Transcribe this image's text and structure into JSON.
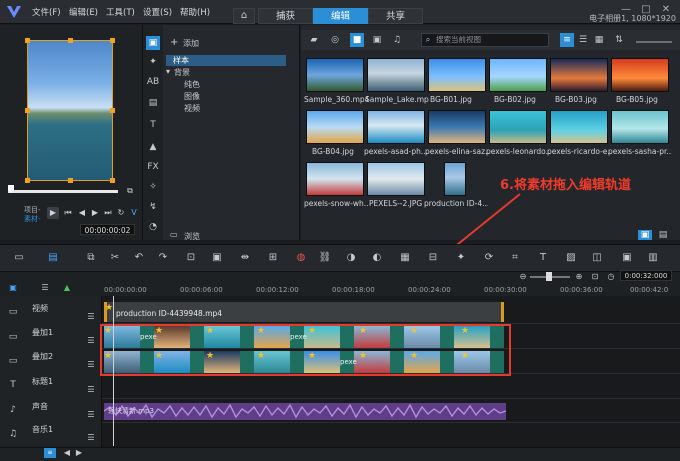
{
  "menu": [
    "文件(F)",
    "编辑(E)",
    "工具(T)",
    "设置(S)",
    "帮助(H)"
  ],
  "tabs": [
    "捕获",
    "编辑",
    "共享"
  ],
  "project_info": "电子相册1, 1080*1920",
  "player": {
    "mode_project": "项目-",
    "mode_clip": "素材-",
    "timecode": "00:00:00:02"
  },
  "library": {
    "add_label": "添加",
    "tree": {
      "sample": "样本",
      "background": "背景",
      "solid": "纯色",
      "image": "图像",
      "video": "视频"
    },
    "browse_label": "浏览",
    "search_placeholder": "搜索当前视图",
    "items": [
      "Sample_360.mp4",
      "Sample_Lake.mp4",
      "BG-B01.jpg",
      "BG-B02.jpg",
      "BG-B03.jpg",
      "BG-B05.jpg",
      "BG-B04.jpg",
      "pexels-asad-ph...",
      "pexels-elina-saz...",
      "pexels-leonardo...",
      "pexels-ricardo-e...",
      "pexels-sasha-pr...",
      "pexels-snow-wh...",
      "PEXELS--2.JPG",
      "production ID-4..."
    ]
  },
  "annotation": "6.将素材拖入编辑轨道",
  "timeline": {
    "timecode_end": "0:00:32:000",
    "ruler": [
      "00:00:00:00",
      "00:00:06:00",
      "00:00:12:00",
      "00:00:18:00",
      "00:00:24:00",
      "00:00:30:00",
      "00:00:36:00",
      "00:00:42:0"
    ],
    "tracks": [
      "视频",
      "叠加1",
      "叠加2",
      "标题1",
      "声音",
      "音乐1"
    ],
    "video_clip": "production ID-4439948.mp4",
    "audio_clip": "轻快清新.mp3",
    "overlay_text": "pexe"
  },
  "colors": {
    "accent": "#2c8fd6",
    "highlight": "#e53b2c",
    "audio": "#5e3f87",
    "overlay": "#1e6f60"
  }
}
